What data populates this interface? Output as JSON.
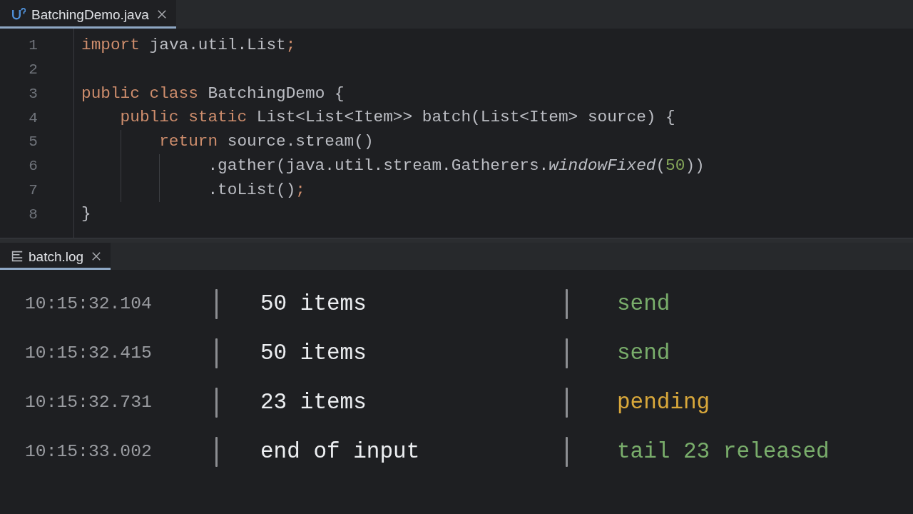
{
  "editor": {
    "tab": {
      "label": "BatchingDemo.java",
      "selected": true
    },
    "lines": [
      {
        "number": "1",
        "tokens": [
          {
            "kind": "keyword",
            "text": "import"
          },
          {
            "kind": "plain",
            "text": " java.util.List"
          },
          {
            "kind": "keyword",
            "text": ";"
          }
        ]
      },
      {
        "number": "2"
      },
      {
        "number": "3",
        "tokens": [
          {
            "kind": "keyword",
            "text": "public class"
          },
          {
            "kind": "plain",
            "text": " BatchingDemo {"
          }
        ]
      },
      {
        "number": "4",
        "tokens": [
          {
            "kind": "keyword",
            "text": "    public static"
          },
          {
            "kind": "plain",
            "text": " List<List<Item>> batch(List<Item> source) {"
          }
        ]
      },
      {
        "number": "5",
        "tokens": [
          {
            "kind": "keyword",
            "text": "        return"
          },
          {
            "kind": "plain",
            "text": " source.stream()"
          }
        ]
      },
      {
        "number": "6",
        "tokens": [
          {
            "kind": "plain",
            "text": "             .gather(java.util.stream.Gatherers."
          },
          {
            "kind": "static_method",
            "text": "windowFixed"
          },
          {
            "kind": "plain",
            "text": "("
          },
          {
            "kind": "number",
            "text": "50"
          },
          {
            "kind": "plain",
            "text": "))"
          }
        ]
      },
      {
        "number": "7",
        "tokens": [
          {
            "kind": "plain",
            "text": "             .toList()"
          },
          {
            "kind": "keyword",
            "text": ";"
          }
        ]
      },
      {
        "number": "8",
        "tokens": [
          {
            "kind": "plain",
            "text": "}"
          }
        ]
      }
    ]
  },
  "log": {
    "tab": {
      "label": "batch.log",
      "selected": true
    },
    "rows": [
      {
        "time": "10:15:32.104",
        "message": "50 items",
        "status": "send",
        "pending": false
      },
      {
        "time": "10:15:32.415",
        "message": "50 items",
        "status": "send",
        "pending": false
      },
      {
        "time": "10:15:32.731",
        "message": "23 items",
        "status": "pending",
        "pending": true
      },
      {
        "time": "10:15:33.002",
        "message": "end of input",
        "status": "tail 23 released",
        "pending": false
      }
    ]
  }
}
